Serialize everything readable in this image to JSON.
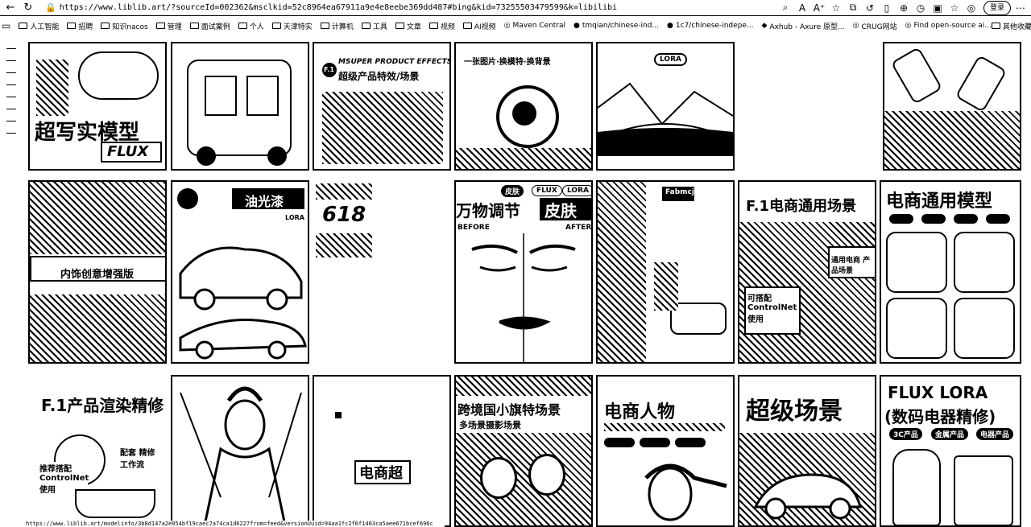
{
  "browser": {
    "url": "https://www.liblib.art/?sourceId=002362&msclkid=52c8964ea67911a9e4e8eebe369dd487#bing&kid=73255503479599&k=libilibi",
    "login_label": "登录"
  },
  "bookmarks": [
    {
      "label": "人工智能",
      "icon": "folder-icon"
    },
    {
      "label": "招聘",
      "icon": "folder-icon"
    },
    {
      "label": "知识nacos",
      "icon": "folder-icon"
    },
    {
      "label": "管理",
      "icon": "folder-icon"
    },
    {
      "label": "面试案例",
      "icon": "folder-icon"
    },
    {
      "label": "个人",
      "icon": "folder-icon"
    },
    {
      "label": "天津特实",
      "icon": "folder-icon"
    },
    {
      "label": "计算机",
      "icon": "folder-icon"
    },
    {
      "label": "工具",
      "icon": "folder-icon"
    },
    {
      "label": "文章",
      "icon": "folder-icon"
    },
    {
      "label": "视频",
      "icon": "folder-icon"
    },
    {
      "label": "AI视频",
      "icon": "folder-icon"
    },
    {
      "label": "Maven Central",
      "icon": "globe-icon"
    },
    {
      "label": "tmqian/chinese-ind...",
      "icon": "github-icon"
    },
    {
      "label": "1c7/chinese-indepe...",
      "icon": "github-icon"
    },
    {
      "label": "Axhub - Axure 原型...",
      "icon": "axhub-icon"
    },
    {
      "label": "CRUG网站",
      "icon": "globe-icon"
    },
    {
      "label": "Find open-source ai...",
      "icon": "globe-icon"
    }
  ],
  "bookmarks_other": "其他收藏夹",
  "cards": {
    "c1": {
      "title": "超写实模型",
      "sub": "FLUX"
    },
    "c3": {
      "title": "MSUPER PRODUCT EFFECTS",
      "sub": "超级产品特效/场景",
      "badge": "F.1"
    },
    "c4": {
      "title": "一张图片·换模特·换背景"
    },
    "c5": {
      "title": "LORA"
    },
    "r2c1": {
      "title": "内饰创意增强版"
    },
    "r2c2": {
      "title": "油光漆",
      "sub": "LORA"
    },
    "r2c3": {
      "title": "618"
    },
    "r2c4": {
      "title": "万物调节",
      "sub": "皮肤",
      "tag1": "皮肤",
      "tag2": "FLUX",
      "tag3": "LORA",
      "before": "BEFORE",
      "after": "AFTER"
    },
    "r2c5": {
      "title": "Fabmcj"
    },
    "r2c6": {
      "title": "F.1电商通用场景",
      "sub": "可搭配 ControlNet 使用",
      "mid": "通用电商 产品场景"
    },
    "r2c7": {
      "title": "电商通用模型"
    },
    "r3c1": {
      "title": "F.1产品渲染精修",
      "sub1": "推荐搭配 ControlNet 使用",
      "sub2": "配套 精修工作流"
    },
    "r3c3": {
      "title": "电商超"
    },
    "r3c4": {
      "title": "跨境国小旗特场景",
      "sub": "多场景摄影场景"
    },
    "r3c5": {
      "title": "电商人物"
    },
    "r3c6": {
      "title": "超级场景"
    },
    "r3c7": {
      "title": "FLUX LORA",
      "sub": "(数码电器精修)",
      "tag1": "3C产品",
      "tag2": "金属产品",
      "tag3": "电器产品"
    }
  },
  "status_url": "https://www.liblib.art/modelinfo/3b8d147a2e054bf19caec7a74ca1d6227from=feed&versionUuid=94aa1fc2f6f1403ca5aee671bcef696c"
}
